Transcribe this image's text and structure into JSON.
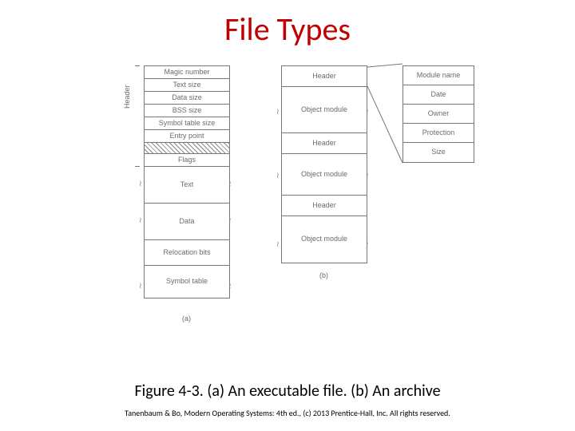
{
  "title": "File Types",
  "caption": "Figure 4-3. (a) An executable file. (b) An archive",
  "copyright": "Tanenbaum & Bo, Modern Operating Systems: 4th ed., (c) 2013 Prentice-Hall, Inc. All rights reserved.",
  "vlabel": "Header",
  "sublabelA": "(a)",
  "sublabelB": "(b)",
  "colA": {
    "magic": "Magic number",
    "text": "Text size",
    "dataS": "Data size",
    "bss": "BSS size",
    "sym": "Symbol table size",
    "entry": "Entry point",
    "flags": "Flags",
    "txt": "Text",
    "data": "Data",
    "reloc": "Relocation bits",
    "stab": "Symbol table"
  },
  "colB": {
    "hdr": "Header",
    "objmod": "Object module"
  },
  "colC": {
    "mod": "Module name",
    "date": "Date",
    "own": "Owner",
    "prot": "Protection",
    "size": "Size"
  }
}
